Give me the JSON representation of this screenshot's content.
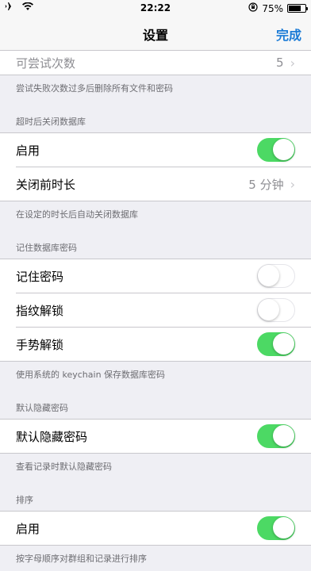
{
  "status_bar": {
    "time": "22:22",
    "battery_text": "75%",
    "battery_level": 0.75
  },
  "nav": {
    "title": "设置",
    "done_label": "完成"
  },
  "sections": {
    "attempts": {
      "row_label": "可尝试次数",
      "row_value": "5",
      "footer": "尝试失败次数过多后删除所有文件和密码"
    },
    "auto_close": {
      "header": "超时后关闭数据库",
      "enable_label": "启用",
      "enable_on": true,
      "duration_label": "关闭前时长",
      "duration_value": "5 分钟",
      "footer": "在设定的时长后自动关闭数据库"
    },
    "remember": {
      "header": "记住数据库密码",
      "remember_label": "记住密码",
      "remember_on": false,
      "fingerprint_label": "指纹解锁",
      "fingerprint_on": false,
      "gesture_label": "手势解锁",
      "gesture_on": true,
      "footer": "使用系统的 keychain 保存数据库密码"
    },
    "hide": {
      "header": "默认隐藏密码",
      "hide_label": "默认隐藏密码",
      "hide_on": true,
      "footer": "查看记录时默认隐藏密码"
    },
    "sort": {
      "header": "排序",
      "enable_label": "启用",
      "enable_on": true,
      "footer": "按字母顺序对群组和记录进行排序"
    }
  },
  "icons": [
    "airplane-icon",
    "wifi-icon",
    "rotation-lock-icon",
    "battery-icon",
    "chevron-right-icon"
  ],
  "colors": {
    "accent": "#1b7bd6",
    "toggle_on": "#4cd964",
    "background": "#efeff4"
  }
}
